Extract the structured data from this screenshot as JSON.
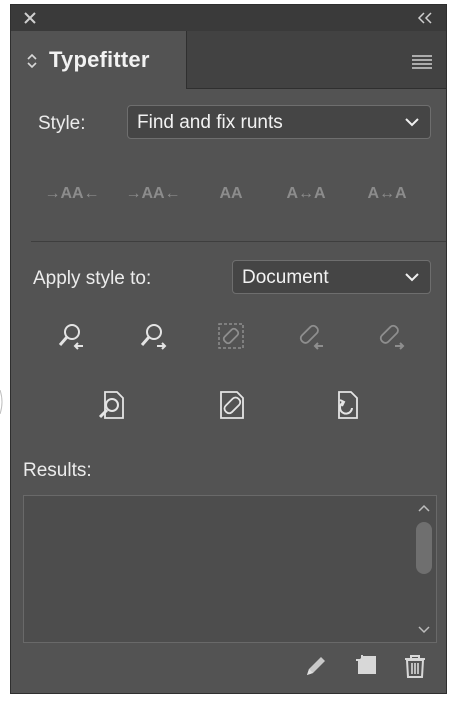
{
  "panel": {
    "tab_title": "Typefitter"
  },
  "style": {
    "label": "Style:",
    "value": "Find and fix runts"
  },
  "fit_buttons": [
    {
      "label": "→AA←",
      "icon": "tighten-both-icon"
    },
    {
      "label": "→AA←",
      "icon": "tighten-icon"
    },
    {
      "label": "AA",
      "icon": "normal-icon"
    },
    {
      "label": "A↔A",
      "icon": "loosen-icon"
    },
    {
      "label": "A↔A",
      "icon": "loosen-both-icon"
    }
  ],
  "apply": {
    "label": "Apply style to:",
    "value": "Document"
  },
  "action_icons": [
    "find-previous-icon",
    "find-next-icon",
    "fix-selection-icon",
    "fix-previous-icon",
    "fix-next-icon",
    "find-all-icon",
    "fix-all-icon",
    "reset-icon"
  ],
  "results": {
    "label": "Results:"
  },
  "footer_icons": [
    "edit-icon",
    "new-icon",
    "delete-icon"
  ]
}
